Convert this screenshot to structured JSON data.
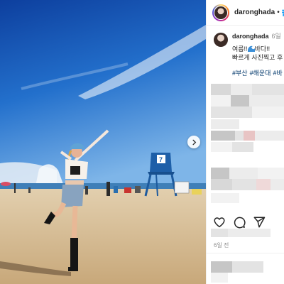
{
  "header": {
    "username": "daronghada",
    "separator": "•",
    "follow_label": "팔로"
  },
  "caption": {
    "username": "daronghada",
    "time": "6일",
    "line1_before": "여름!!",
    "line1_after": "바다!!",
    "line2": "빠르게 사진찍고 후",
    "hashtags": [
      "#부산",
      "#해운대",
      "#바"
    ]
  },
  "post": {
    "age": "6일 전"
  },
  "icons": [
    "heart-icon",
    "comment-icon",
    "share-icon",
    "chevron-right-icon",
    "wave-emoji-icon"
  ],
  "colors": {
    "accent": "#0095f6",
    "hashtag": "#00376b",
    "sky": "#2c74c9",
    "sand": "#d9c19c"
  }
}
